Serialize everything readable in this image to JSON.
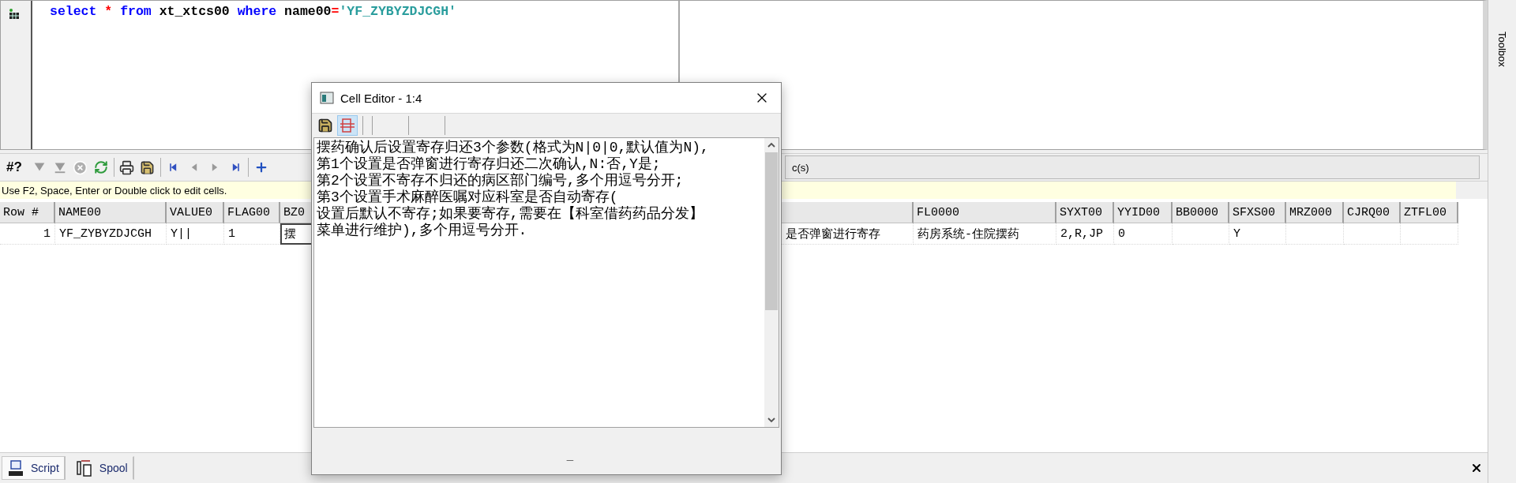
{
  "editor": {
    "sql_tokens": [
      {
        "kind": "keyword",
        "text": "select "
      },
      {
        "kind": "operator",
        "text": "* "
      },
      {
        "kind": "keyword",
        "text": "from "
      },
      {
        "kind": "plain",
        "text": "xt_xtcs00 "
      },
      {
        "kind": "keyword",
        "text": "where "
      },
      {
        "kind": "plain",
        "text": "name00"
      },
      {
        "kind": "operator",
        "text": "="
      },
      {
        "kind": "string",
        "text": "'YF_ZYBYZDJCGH'"
      }
    ]
  },
  "toolbar": {
    "items": [
      {
        "kind": "text",
        "label": "#?",
        "disabled": false
      },
      {
        "kind": "filter",
        "disabled": true
      },
      {
        "kind": "clear-filter",
        "disabled": true
      },
      {
        "kind": "cancel",
        "disabled": true
      },
      {
        "kind": "refresh",
        "disabled": false
      },
      {
        "kind": "separator"
      },
      {
        "kind": "print",
        "disabled": false
      },
      {
        "kind": "save",
        "disabled": false
      },
      {
        "kind": "separator"
      },
      {
        "kind": "first",
        "disabled": false
      },
      {
        "kind": "prev",
        "disabled": true
      },
      {
        "kind": "next",
        "disabled": true
      },
      {
        "kind": "last",
        "disabled": false
      },
      {
        "kind": "separator"
      },
      {
        "kind": "add",
        "disabled": false
      }
    ],
    "status": "c(s)"
  },
  "hint": "Use F2, Space, Enter or Double click to edit cells.",
  "grid": {
    "columns": [
      {
        "label": "Row #"
      },
      {
        "label": "NAME00"
      },
      {
        "label": "VALUE0"
      },
      {
        "label": "FLAG00"
      },
      {
        "label": "BZ0"
      },
      {},
      {
        "label": "FL0000"
      },
      {
        "label": "SYXT00"
      },
      {
        "label": "YYID00"
      },
      {
        "label": "BB0000"
      },
      {
        "label": "SFXS00"
      },
      {
        "label": "MRZ000"
      },
      {
        "label": "CJRQ00"
      },
      {
        "label": "ZTFL00"
      }
    ],
    "rows": [
      {
        "cells": [
          {
            "text": "1",
            "focused": false
          },
          {
            "text": "YF_ZYBYZDJCGH",
            "focused": false
          },
          {
            "text": "Y||",
            "focused": false
          },
          {
            "text": "1",
            "focused": false
          },
          {
            "text": "摆",
            "focused": true
          },
          {
            "text": "是否弹窗进行寄存",
            "focused": false
          },
          {
            "text": "药房系统-住院摆药",
            "focused": false
          },
          {
            "text": "2,R,JP",
            "focused": false
          },
          {
            "text": "0",
            "focused": false
          },
          {
            "focused": false
          },
          {
            "text": "Y",
            "focused": false
          },
          {
            "focused": false
          },
          {
            "focused": false
          },
          {
            "focused": false
          }
        ]
      }
    ]
  },
  "dialog": {
    "title": "Cell Editor - 1:4",
    "toolbar": [
      {
        "kind": "save",
        "selected": false
      },
      {
        "kind": "wrap",
        "selected": true
      }
    ],
    "lines": [
      "摆药确认后设置寄存归还3个参数(格式为N|0|0,默认值为N),",
      "第1个设置是否弹窗进行寄存归还二次确认,N:否,Y是;",
      "第2个设置不寄存不归还的病区部门编号,多个用逗号分开;",
      "第3个设置手术麻醉医嘱对应科室是否自动寄存(",
      "设置后默认不寄存;如果要寄存,需要在【科室借药药品分发】",
      "菜单进行维护),多个用逗号分开."
    ],
    "status": "_"
  },
  "bottom_tabs": [
    {
      "kind": "script",
      "label": "Script",
      "selected": true
    },
    {
      "kind": "spool",
      "label": "Spool",
      "selected": false
    }
  ],
  "toolbox": {
    "label": "Toolbox"
  }
}
